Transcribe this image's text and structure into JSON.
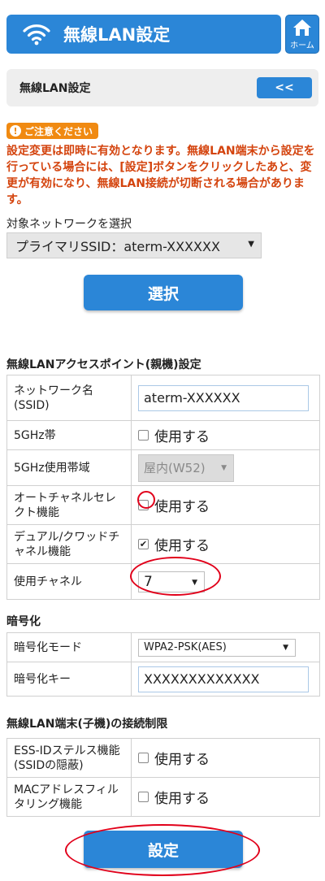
{
  "header": {
    "title": "無線LAN設定",
    "home_label": "ホーム"
  },
  "subbar": {
    "title": "無線LAN設定",
    "back_label": "<<"
  },
  "caution": {
    "badge": "ご注意ください",
    "text": "設定変更は即時に有効となります。無線LAN端末から設定を行っている場合には、[設定]ボタンをクリックしたあと、変更が有効になり、無線LAN接続が切断される場合があります。"
  },
  "network_select": {
    "label": "対象ネットワークを選択",
    "value": "プライマリSSID：aterm-XXXXXX",
    "button": "選択"
  },
  "ap_section": {
    "title": "無線LANアクセスポイント(親機)設定",
    "rows": {
      "ssid": {
        "label": "ネットワーク名(SSID)",
        "value": "aterm-XXXXXX"
      },
      "band5g": {
        "label": "5GHz帯",
        "option": "使用する"
      },
      "band5g_range": {
        "label": "5GHz使用帯域",
        "value": "屋内(W52)"
      },
      "auto_channel": {
        "label": "オートチャネルセレクト機能",
        "option": "使用する"
      },
      "dual_quad": {
        "label": "デュアル/クワッドチャネル機能",
        "option": "使用する"
      },
      "channel": {
        "label": "使用チャネル",
        "value": "7"
      }
    }
  },
  "encryption": {
    "title": "暗号化",
    "mode_label": "暗号化モード",
    "mode_value": "WPA2-PSK(AES)",
    "key_label": "暗号化キー",
    "key_value": "XXXXXXXXXXXXX"
  },
  "restriction": {
    "title": "無線LAN端末(子機)の接続制限",
    "stealth": {
      "label": "ESS-IDステルス機能(SSIDの隠蔽)",
      "option": "使用する"
    },
    "mac": {
      "label": "MACアドレスフィルタリング機能",
      "option": "使用する"
    }
  },
  "submit": {
    "label": "設定"
  },
  "colors": {
    "primary": "#2b86d7",
    "warning": "#d4440e",
    "badge": "#f08a12",
    "highlight": "#e1001a"
  }
}
